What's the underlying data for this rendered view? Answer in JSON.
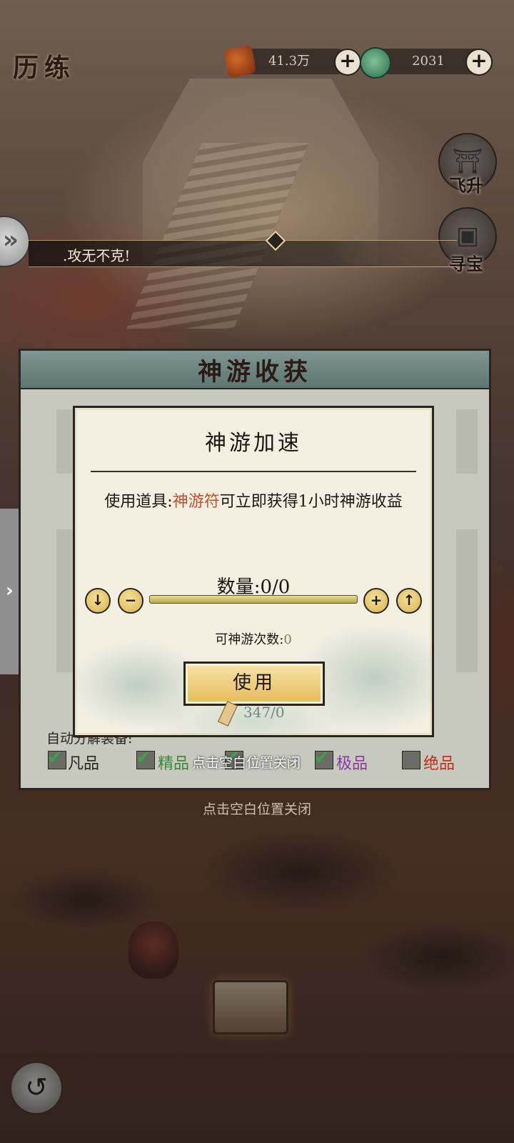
{
  "header": {
    "title": "历练",
    "copper": "41.3万",
    "jade": "2031",
    "plus_label": "+"
  },
  "side": {
    "feisheng": "飞升",
    "xunbao": "寻宝"
  },
  "marquee": {
    "text": ".攻无不克!"
  },
  "outer_dialog": {
    "title": "神游收获",
    "auto_decompose_label": "自动分解装备:",
    "qualities": [
      "凡品",
      "精品",
      "",
      "极品",
      "绝品"
    ],
    "close_hint_inner": "点击空白位置关闭",
    "close_hint": "点击空白位置关闭"
  },
  "inner_dialog": {
    "title": "神游加速",
    "desc_prefix": "使用道具:",
    "desc_item": "神游符",
    "desc_suffix": "可立即获得1小时神游收益",
    "quantity_label": "数量:0/0",
    "remaining_times_label": "可神游次数:",
    "remaining_times_value": "0",
    "use_button": "使用",
    "item_count": "347/0",
    "btn_min": "↓",
    "btn_minus": "−",
    "btn_plus": "+",
    "btn_max": "↑",
    "quantity_fraction": 0
  },
  "colors": {
    "highlight": "#c0502a",
    "fine_quality": "#3a8a3a",
    "epic_quality": "#8a3aa0",
    "legend_quality": "#c03020"
  }
}
